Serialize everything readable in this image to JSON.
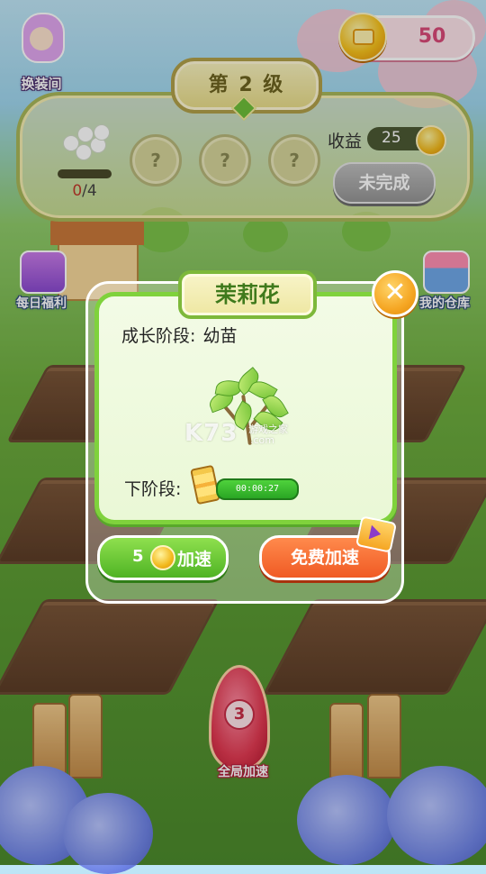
{
  "hud": {
    "character_label": "换装间",
    "coins": "50"
  },
  "level_panel": {
    "title": "第 2 级",
    "progress_current": "0",
    "progress_total": "/4",
    "locked_slot_symbol": "?",
    "income_label": "收益",
    "income_value": "25",
    "status_button": "未完成"
  },
  "side_buttons": {
    "daily_welfare": "每日福利",
    "my_warehouse": "我的仓库"
  },
  "plant_dialog": {
    "title": "茉莉花",
    "close_symbol": "✕",
    "stage_label": "成长阶段",
    "stage_separator": ":",
    "stage_value": "幼苗",
    "next_stage_label": "下阶段:",
    "timer": "00:00:27",
    "speed_up_cost": "5",
    "speed_up_label": "加速",
    "free_speed_up_label": "免费加速",
    "watermark": "K73",
    "watermark_sub": "游戏之家",
    "watermark_domain": ".com"
  },
  "bottom": {
    "rocket_number": "3",
    "rocket_label": "全局加速"
  },
  "colors": {
    "dialog_border": "#7fd23c",
    "speed_button": "#4fb324",
    "free_button": "#f05a24",
    "coin": "#f2b91c"
  }
}
